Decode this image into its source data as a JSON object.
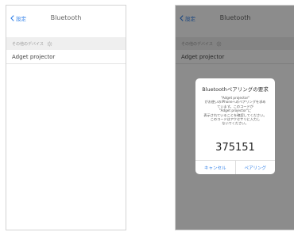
{
  "left_screen": {
    "back_label": "設定",
    "title": "Bluetooth",
    "section_header": "その他のデバイス",
    "device_name": "Adget projector"
  },
  "right_screen": {
    "back_label": "設定",
    "title": "Bluetooth",
    "section_header": "その他のデバイス",
    "device_name": "Adget projector",
    "dialog": {
      "title": "Bluetoothペアリングの要求",
      "message": "\"Adget projector\"\nがお使いのiPhoneへのペアリングを求め\nています。このコードが\n\"Adget projector\"に\n表示されていることを確認してください。\nこのコードはアクセサリに入力し\nないでください。",
      "code": "375151",
      "cancel_label": "キャンセル",
      "pair_label": "ペアリング"
    }
  },
  "colors": {
    "accent": "#2f7fe8",
    "section_bg": "#efefef",
    "overlay": "rgba(0,0,0,0.45)"
  },
  "icons": {
    "back": "chevron-left-icon",
    "loading": "spinner-icon"
  }
}
